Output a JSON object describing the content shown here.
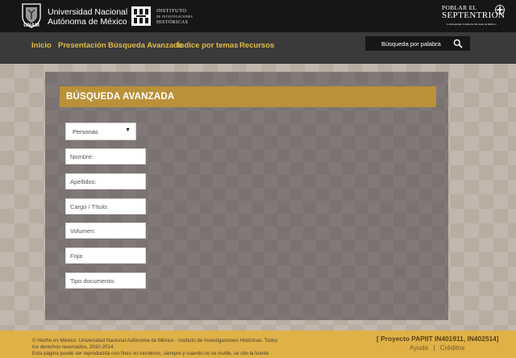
{
  "header": {
    "unam_name_line1": "Universidad Nacional",
    "unam_name_line2": "Autónoma de México",
    "unam_logo_text": "UNAM",
    "iih_line1": "INSTITUTO",
    "iih_line2": "DE INVESTIGACIONES",
    "iih_line3": "HISTÓRICAS",
    "ps_line1": "POBLAR EL",
    "ps_line2": "SEPTENTRION",
    "ps_tagline": "Construyendo la historia del norte de México"
  },
  "nav": {
    "items": [
      "Inicio",
      "Presentación",
      "Búsqueda Avanzada",
      "Índice por temas",
      "Recursos"
    ],
    "search_label": "Búsqueda por palabra"
  },
  "form": {
    "title": "BÚSQUEDA AVANZADA",
    "select_value": "Personas",
    "fields": [
      "Nombre:",
      "Apellidos:",
      "Cargo / Título:",
      "Volumen:",
      "Foja:",
      "Tipo documento:"
    ]
  },
  "footer": {
    "text_line1": "© Hecho en México. Universidad Nacional Autónoma de México - Instituto de Investigaciones Históricas. Todos",
    "text_line2": "los derechos reservados, 2010-2014.",
    "text_line3": "Esta página puede ser reproducida con fines no lucrativos, siempre y cuando no se mutile, se cite la fuente",
    "project": "[ Proyecto PAPIIT IN401911, IN402514]",
    "link_help": "Ayuda",
    "link_sep": "|",
    "link_credits": "Créditos"
  },
  "colors": {
    "accent_gold": "#ba9138",
    "nav_text": "#e2bc47",
    "footer_bg": "#dfb147",
    "panel_bg": "#7b7371"
  }
}
